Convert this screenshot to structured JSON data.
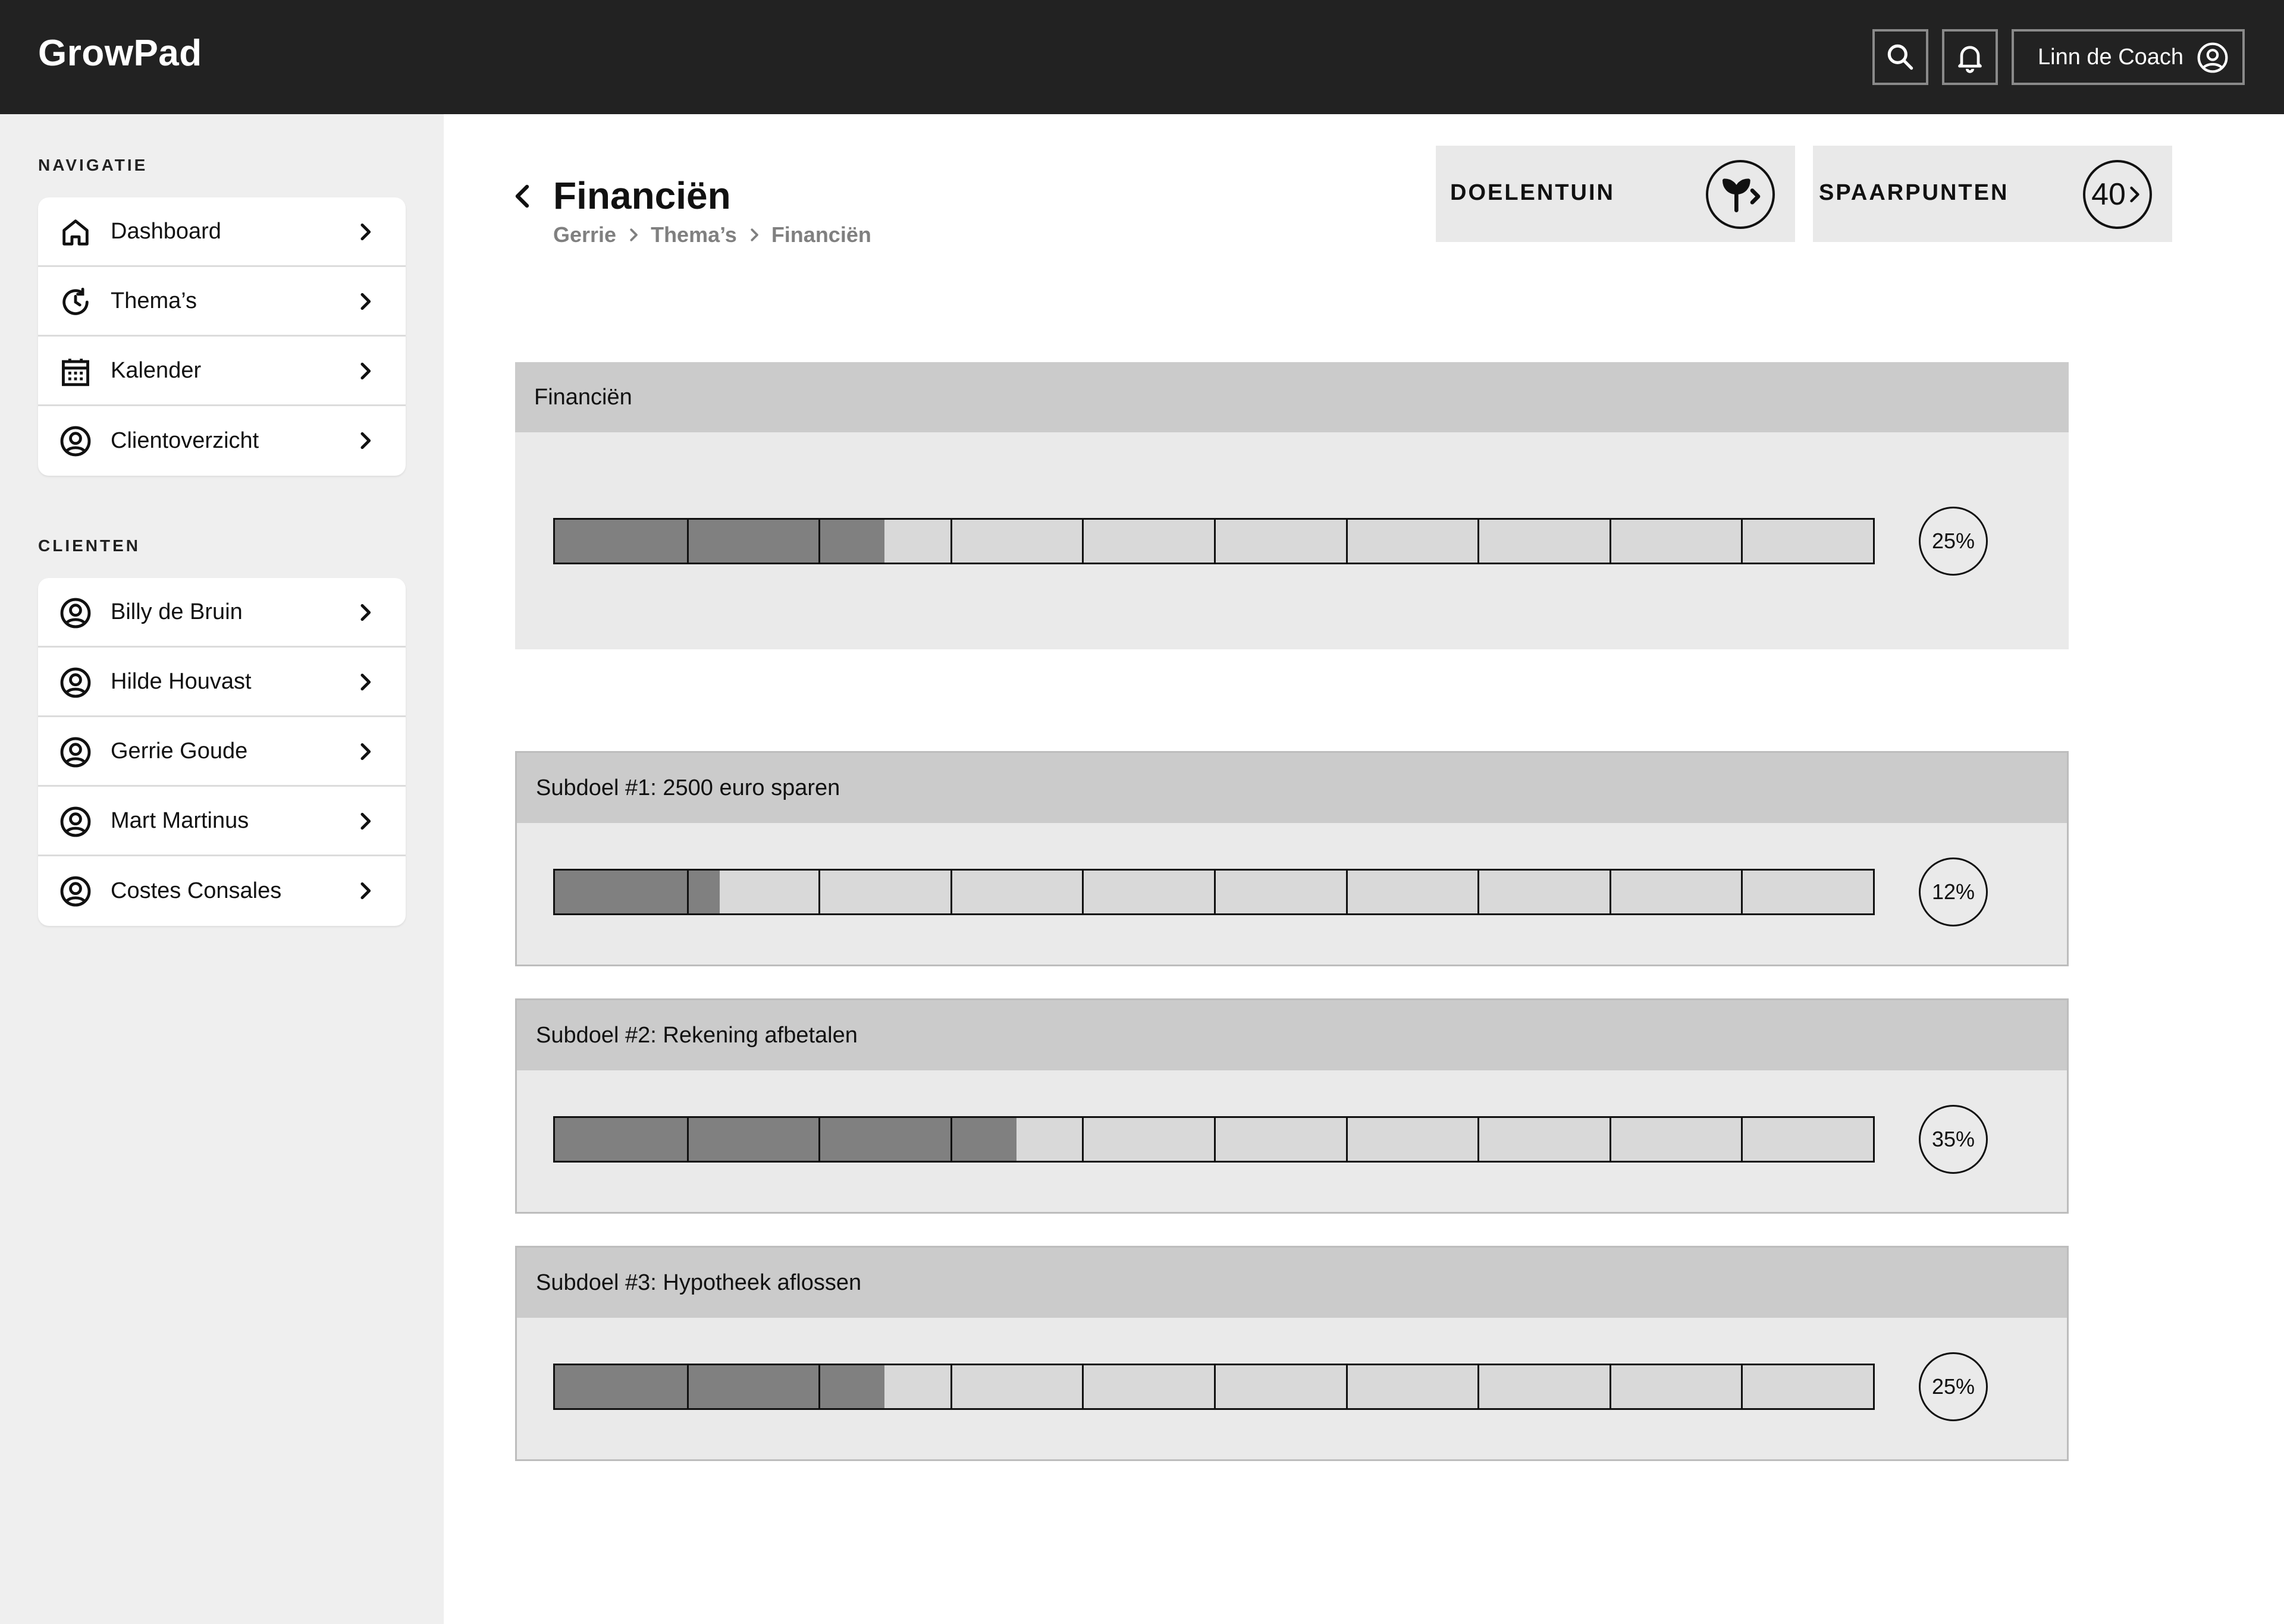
{
  "app": {
    "brand": "GrowPad",
    "user_name": "Linn de Coach"
  },
  "sidebar": {
    "nav_label": "NAVIGATIE",
    "nav_items": [
      {
        "label": "Dashboard",
        "icon": "home-icon"
      },
      {
        "label": "Thema’s",
        "icon": "clock-refresh-icon"
      },
      {
        "label": "Kalender",
        "icon": "calendar-icon"
      },
      {
        "label": "Clientoverzicht",
        "icon": "user-circle-icon"
      }
    ],
    "clients_label": "CLIENTEN",
    "clients": [
      {
        "label": "Billy de Bruin",
        "icon": "user-circle-icon"
      },
      {
        "label": "Hilde Houvast",
        "icon": "user-circle-icon"
      },
      {
        "label": "Gerrie Goude",
        "icon": "user-circle-icon"
      },
      {
        "label": "Mart Martinus",
        "icon": "user-circle-icon"
      },
      {
        "label": "Costes Consales",
        "icon": "user-circle-icon"
      }
    ]
  },
  "header": {
    "title": "Financiën",
    "breadcrumb": [
      "Gerrie",
      "Thema’s",
      "Financiën"
    ]
  },
  "stats": {
    "doelentuin": {
      "label": "DOELENTUIN",
      "icon": "sprout-icon"
    },
    "spaarpunten": {
      "label": "SPAARPUNTEN",
      "value": "40"
    }
  },
  "goals": {
    "main": {
      "title": "Financiën",
      "percent_label": "25%",
      "progress": 0.25
    },
    "subgoals": [
      {
        "title": "Subdoel #1: 2500 euro sparen",
        "percent_label": "12%",
        "progress": 0.125
      },
      {
        "title": "Subdoel #2: Rekening afbetalen",
        "percent_label": "35%",
        "progress": 0.35
      },
      {
        "title": "Subdoel #3: Hypotheek aflossen",
        "percent_label": "25%",
        "progress": 0.25
      }
    ],
    "segments": 10
  },
  "colors": {
    "topbar": "#222222",
    "sidebar": "#efefef",
    "panel": "#eaeaea",
    "panel_header": "#cbcbcb",
    "bar_fill": "#808080",
    "bar_empty": "#d9d9d9"
  }
}
